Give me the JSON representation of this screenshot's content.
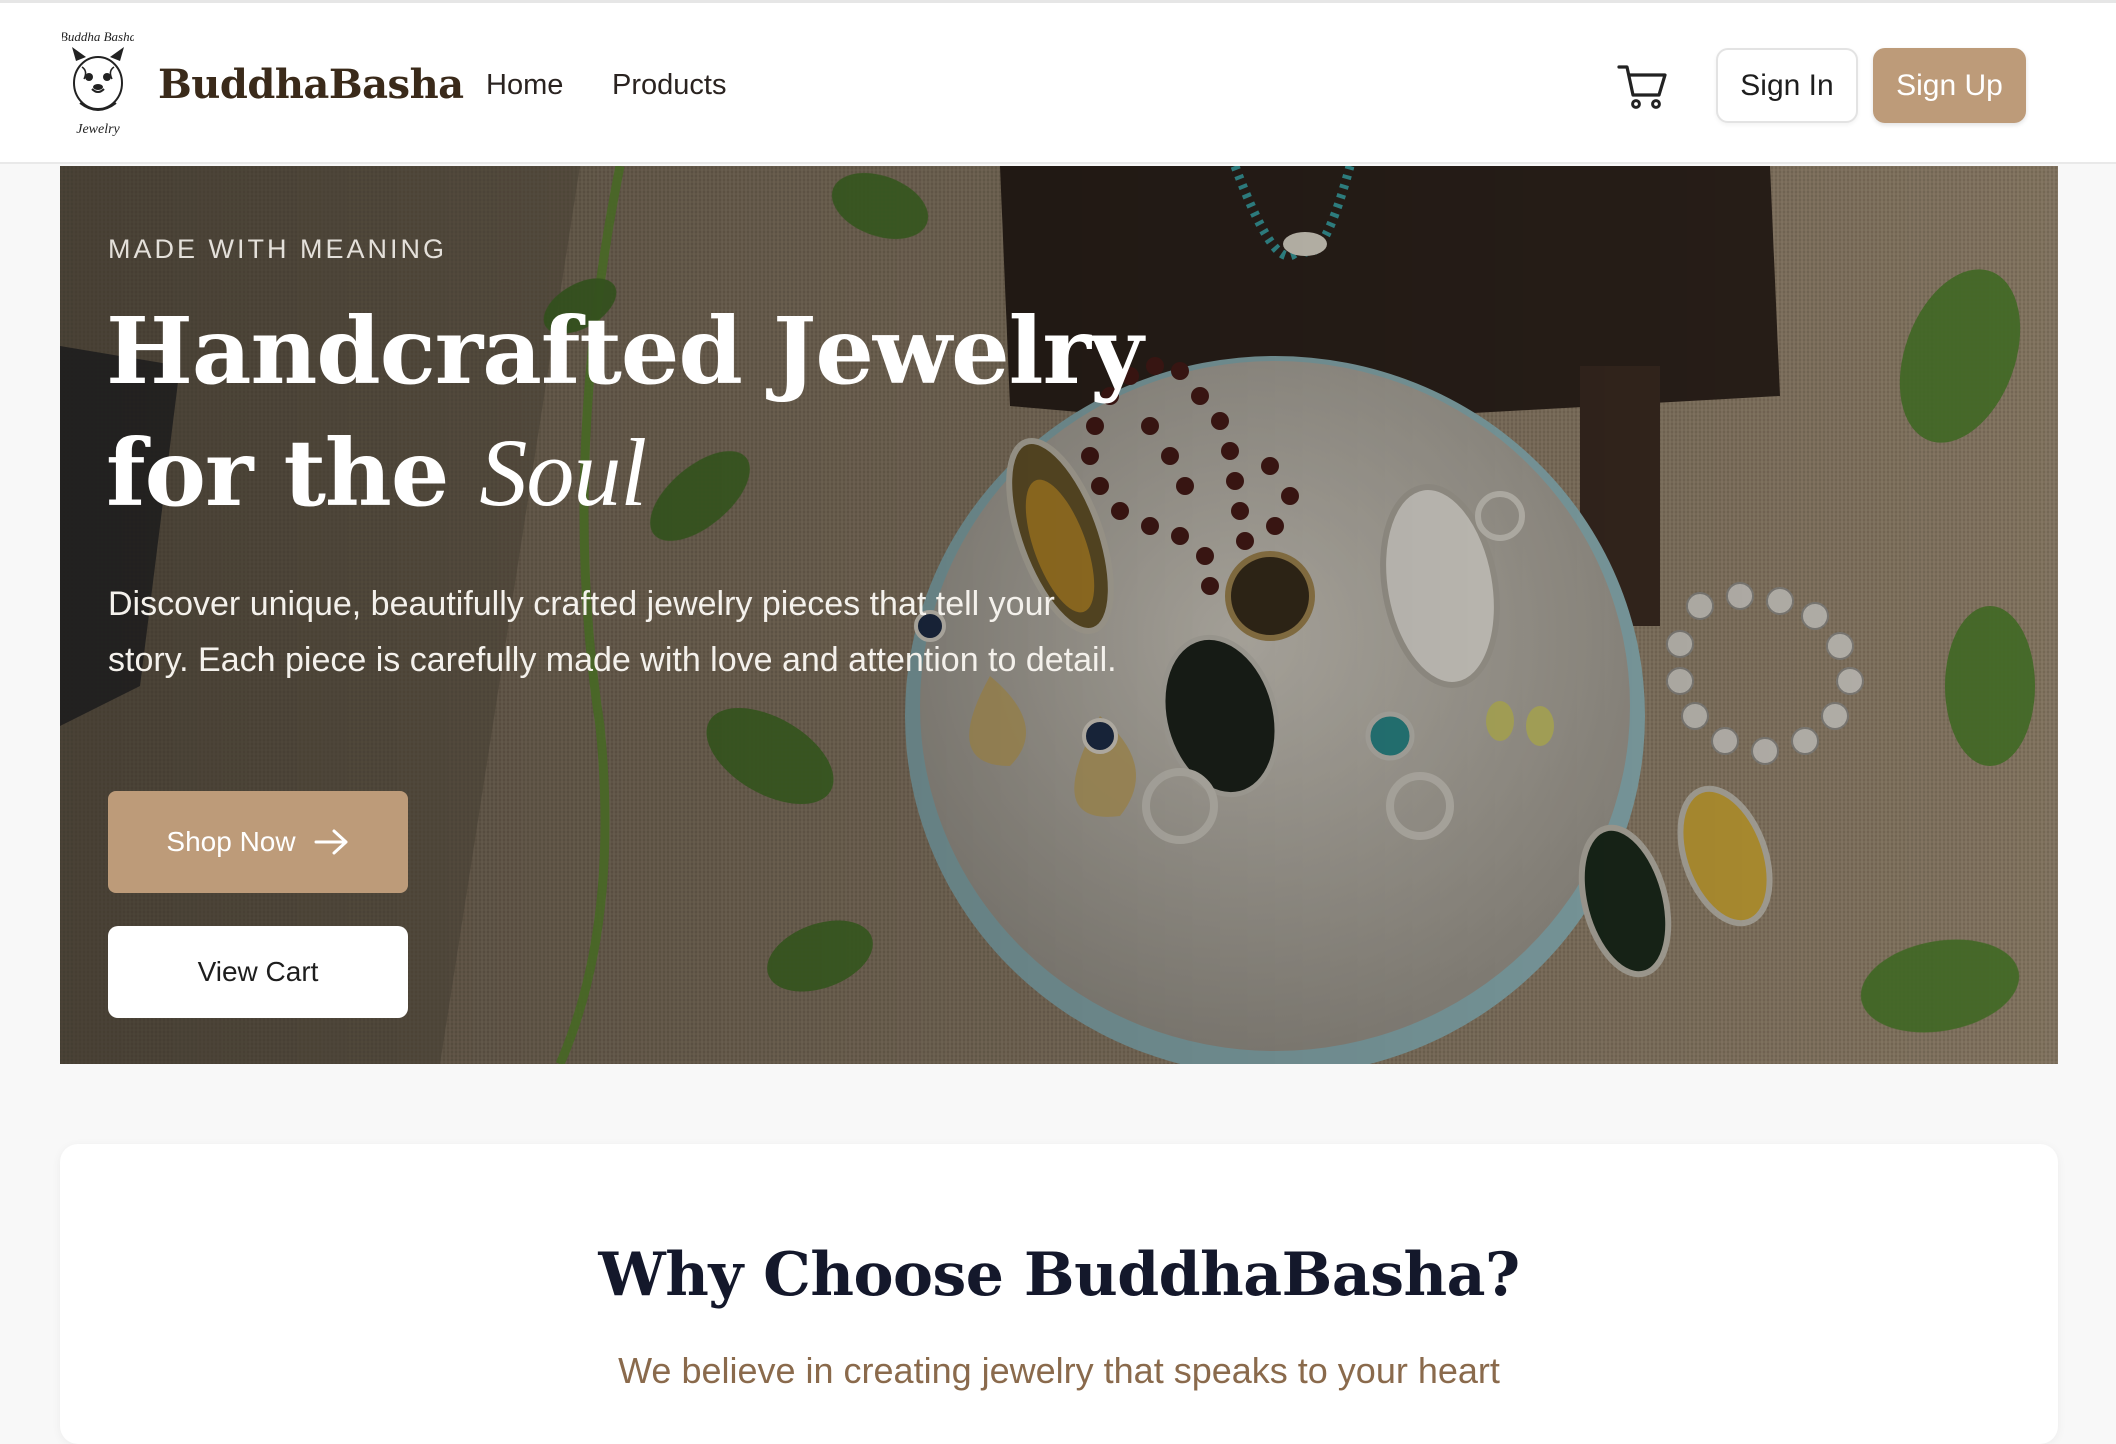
{
  "header": {
    "logo_text_top": "Buddha Basha",
    "logo_text_bottom": "Jewelry",
    "brand": "BuddhaBasha",
    "nav": [
      {
        "label": "Home"
      },
      {
        "label": "Products"
      }
    ],
    "cart_icon": "shopping-cart-icon",
    "sign_in": "Sign In",
    "sign_up": "Sign Up"
  },
  "hero": {
    "eyebrow": "MADE WITH MEANING",
    "title_line1": "Handcrafted Jewelry",
    "title_line2_prefix": "for the ",
    "title_line2_accent": "Soul",
    "description": "Discover unique, beautifully crafted jewelry pieces that tell your story. Each piece is carefully made with love and attention to detail.",
    "shop_now": "Shop Now",
    "shop_now_icon": "arrow-right-icon",
    "view_cart": "View Cart"
  },
  "why": {
    "title": "Why Choose BuddhaBasha?",
    "subtitle": "We believe in creating jewelry that speaks to your heart"
  },
  "colors": {
    "accent": "#bd9b79",
    "brand_text": "#3a2a1a",
    "heading_dark": "#14182b",
    "subtitle_brown": "#8a6a4c",
    "page_bg": "#f8f8f8"
  }
}
